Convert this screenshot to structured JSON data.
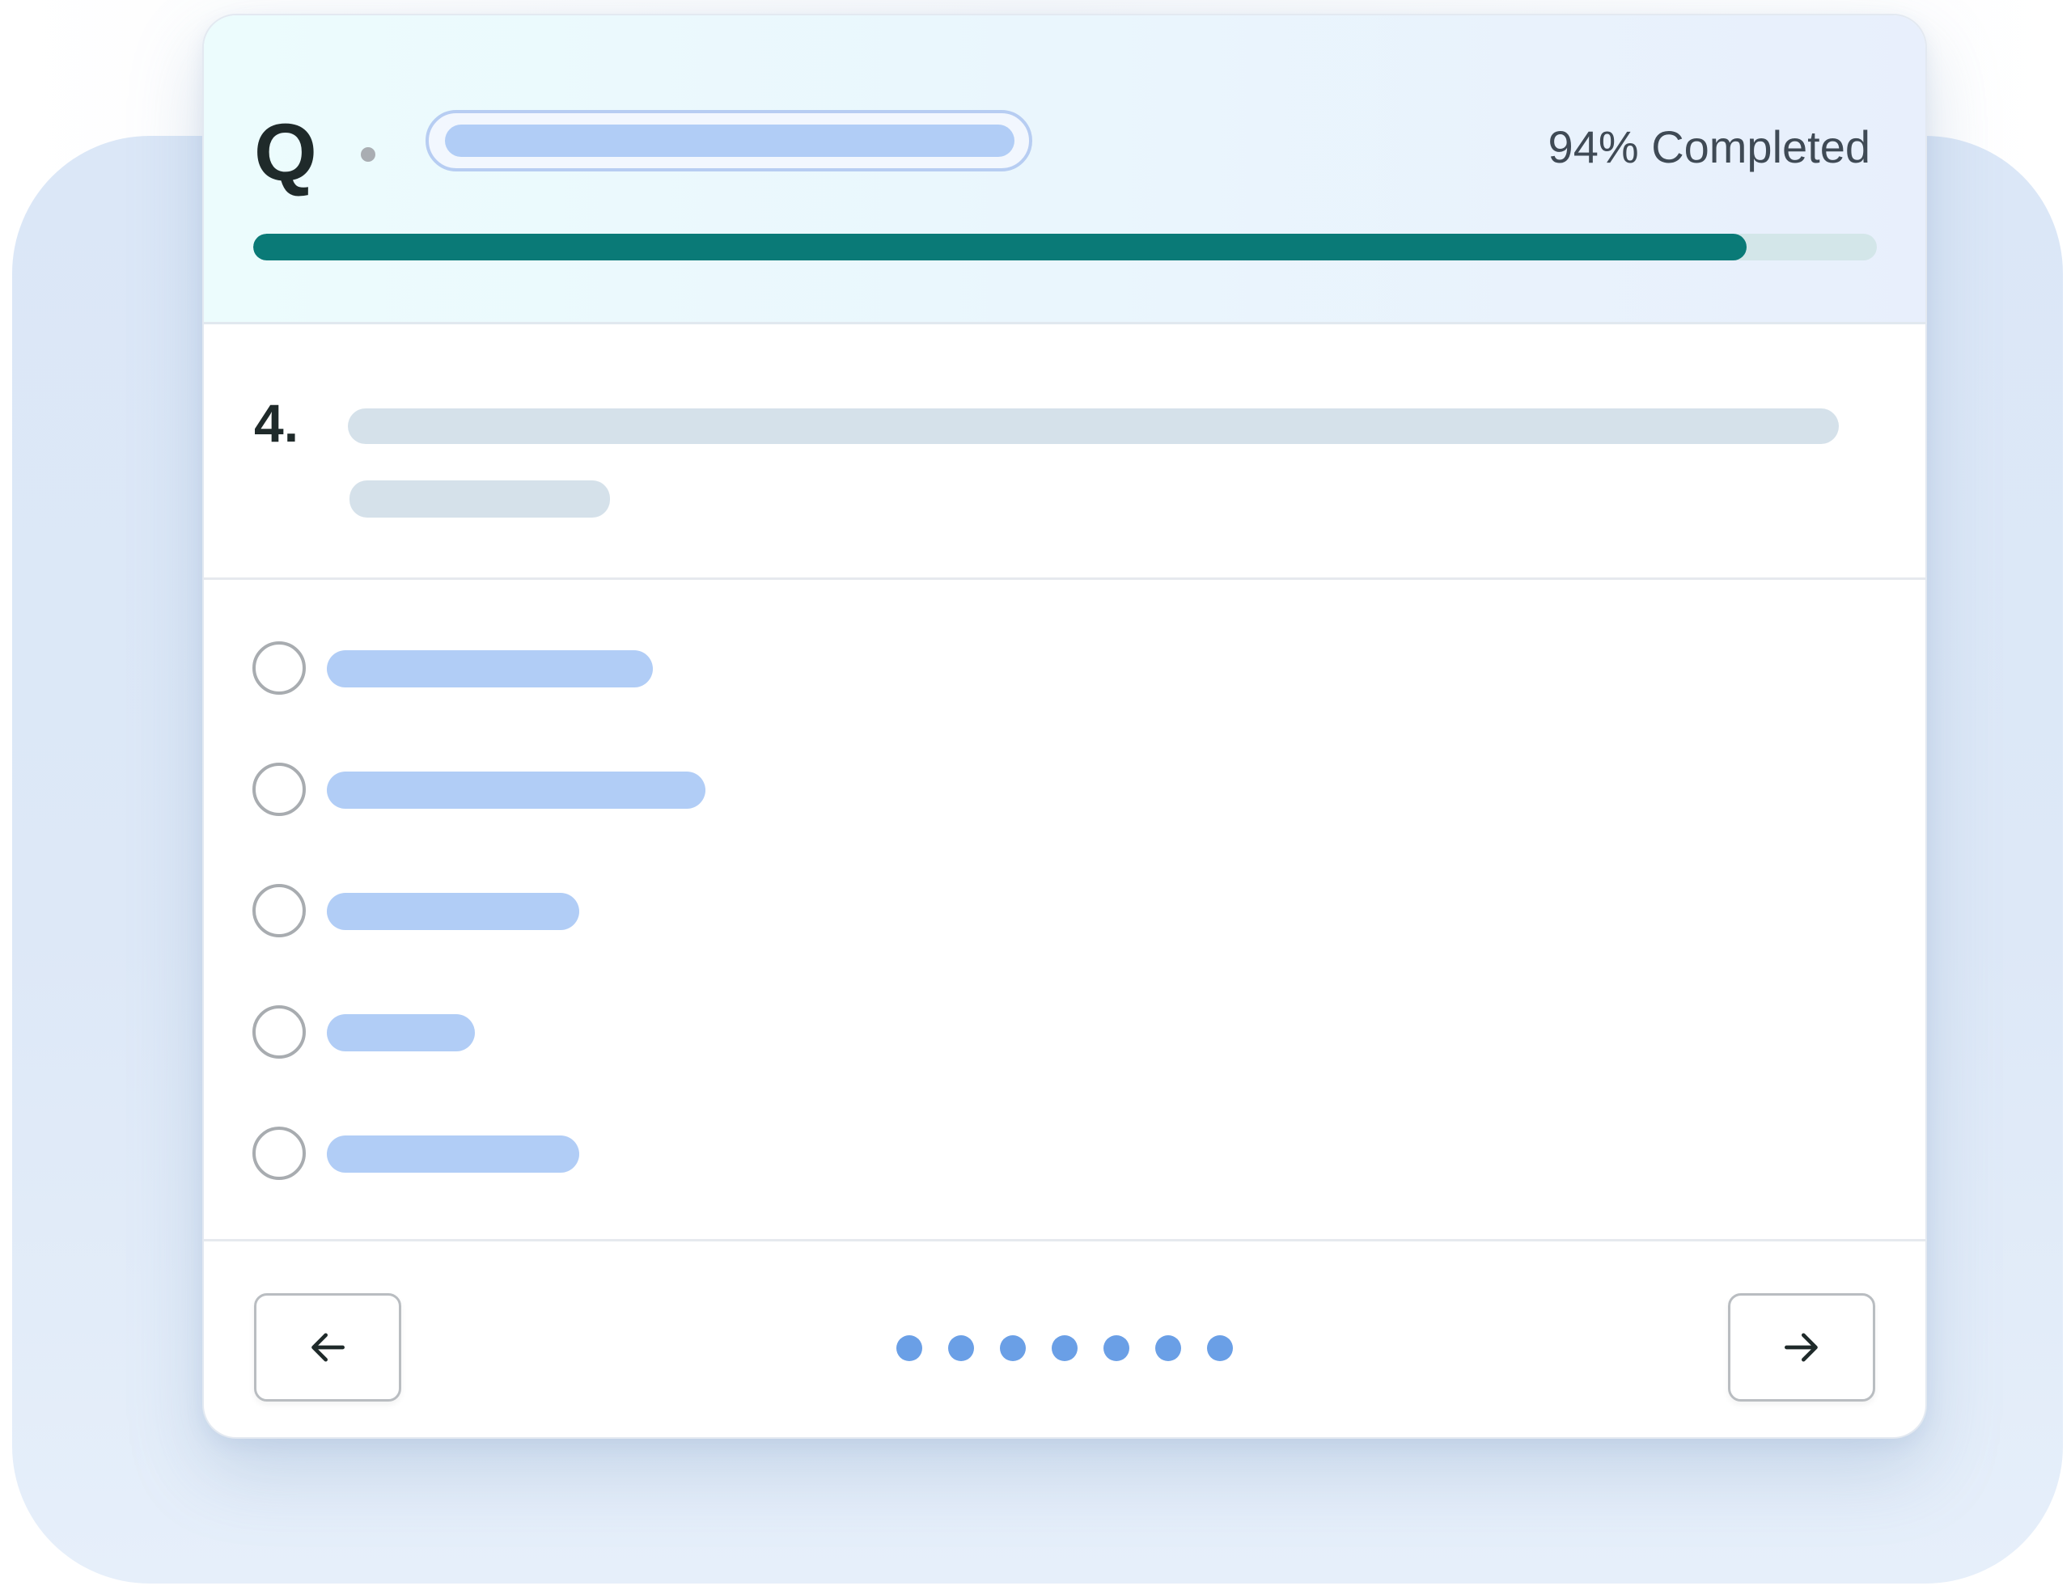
{
  "header": {
    "logo_letter": "Q",
    "completion_text": "94% Completed",
    "progress_percent": 92
  },
  "question": {
    "number": "4."
  },
  "options": {
    "count": 5,
    "selected_index": null
  },
  "pagination": {
    "dot_count": 7
  },
  "icons": {
    "prev": "arrow-left-icon",
    "next": "arrow-right-icon"
  },
  "colors": {
    "progress_fill": "#0a7a77",
    "progress_track": "#d3e6e9",
    "placeholder_blue": "#b1cdf6",
    "placeholder_gray": "#d5e1ea",
    "page_dot": "#6a9fe6",
    "text_dark": "#1f2a2a"
  }
}
